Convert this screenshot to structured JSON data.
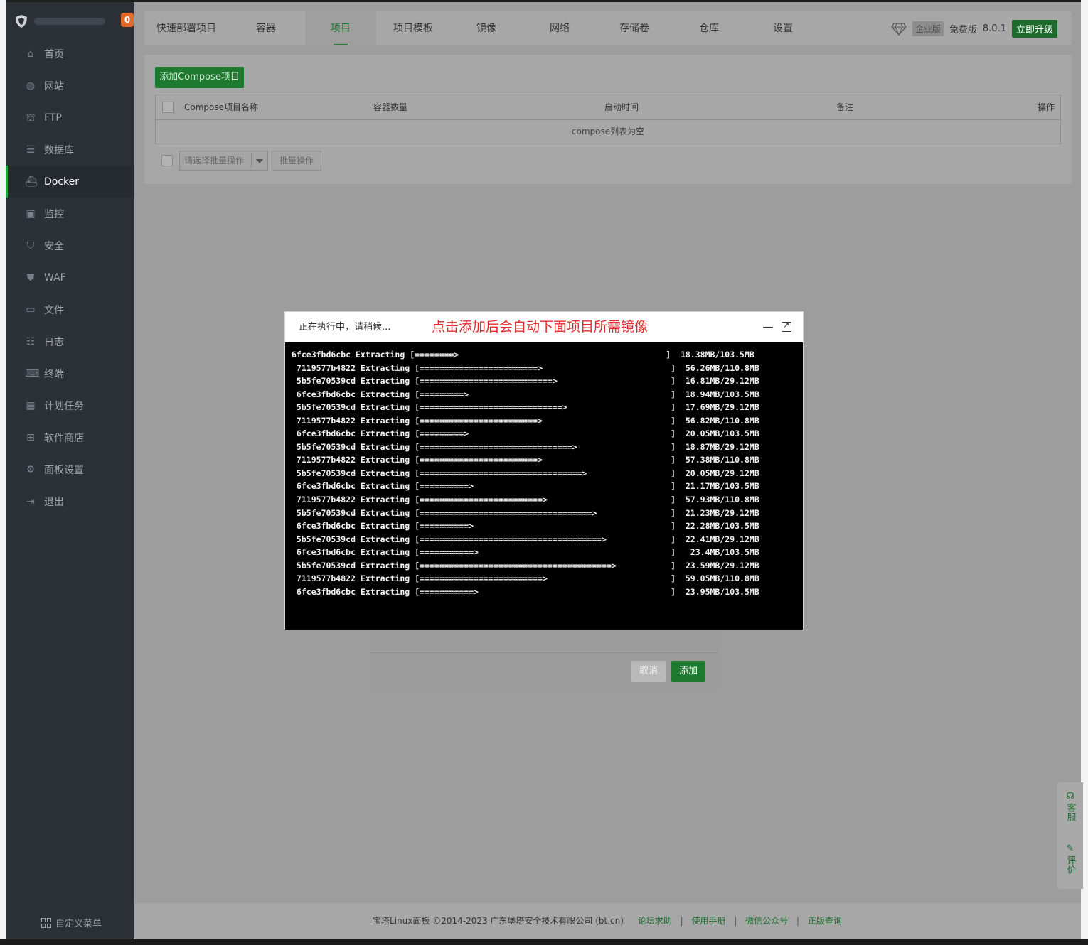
{
  "sidebar": {
    "badge_count": "0",
    "items": [
      {
        "label": "首页",
        "icon": "home-icon"
      },
      {
        "label": "网站",
        "icon": "globe-icon"
      },
      {
        "label": "FTP",
        "icon": "ftp-icon"
      },
      {
        "label": "数据库",
        "icon": "database-icon"
      },
      {
        "label": "Docker",
        "icon": "docker-icon"
      },
      {
        "label": "监控",
        "icon": "monitor-icon"
      },
      {
        "label": "安全",
        "icon": "shield-icon"
      },
      {
        "label": "WAF",
        "icon": "waf-shield-icon"
      },
      {
        "label": "文件",
        "icon": "folder-icon"
      },
      {
        "label": "日志",
        "icon": "log-icon"
      },
      {
        "label": "终端",
        "icon": "terminal-icon"
      },
      {
        "label": "计划任务",
        "icon": "calendar-icon"
      },
      {
        "label": "软件商店",
        "icon": "apps-icon"
      },
      {
        "label": "面板设置",
        "icon": "gear-icon"
      },
      {
        "label": "退出",
        "icon": "logout-icon"
      }
    ],
    "active": "Docker",
    "custom_menu": "自定义菜单"
  },
  "topnav": {
    "tabs": [
      "快速部署项目",
      "容器",
      "项目",
      "项目模板",
      "镜像",
      "网络",
      "存储卷",
      "仓库",
      "设置"
    ],
    "active_tab": "项目",
    "enterprise": "企业版",
    "free": "免费版",
    "version": "8.0.1",
    "upgrade": "立即升级"
  },
  "content": {
    "add_button": "添加Compose项目",
    "columns": [
      "Compose项目名称",
      "容器数量",
      "启动时间",
      "备注",
      "操作"
    ],
    "empty_text": "compose列表为空",
    "batch_select_placeholder": "请选择批量操作",
    "batch_button": "批量操作"
  },
  "form_dialog": {
    "cancel": "取消",
    "add": "添加"
  },
  "modal": {
    "title": "正在执行中，请稍候...",
    "annotation": "点击添加后会自动下面项目所需镜像",
    "log_lines": [
      "6fce3fbd6cbc Extracting [========>                                          ]  18.38MB/103.5MB",
      " 7119577b4822 Extracting [========================>                          ]  56.26MB/110.8MB",
      " 5b5fe70539cd Extracting [===========================>                       ]  16.81MB/29.12MB",
      " 6fce3fbd6cbc Extracting [=========>                                         ]  18.94MB/103.5MB",
      " 5b5fe70539cd Extracting [=============================>                     ]  17.69MB/29.12MB",
      " 7119577b4822 Extracting [========================>                          ]  56.82MB/110.8MB",
      " 6fce3fbd6cbc Extracting [=========>                                         ]  20.05MB/103.5MB",
      " 5b5fe70539cd Extracting [===============================>                   ]  18.87MB/29.12MB",
      " 7119577b4822 Extracting [========================>                          ]  57.38MB/110.8MB",
      " 5b5fe70539cd Extracting [=================================>                 ]  20.05MB/29.12MB",
      " 6fce3fbd6cbc Extracting [==========>                                        ]  21.17MB/103.5MB",
      " 7119577b4822 Extracting [=========================>                         ]  57.93MB/110.8MB",
      " 5b5fe70539cd Extracting [===================================>               ]  21.23MB/29.12MB",
      " 6fce3fbd6cbc Extracting [==========>                                        ]  22.28MB/103.5MB",
      " 5b5fe70539cd Extracting [=====================================>             ]  22.41MB/29.12MB",
      " 6fce3fbd6cbc Extracting [===========>                                       ]   23.4MB/103.5MB",
      " 5b5fe70539cd Extracting [=======================================>           ]  23.59MB/29.12MB",
      " 7119577b4822 Extracting [=========================>                         ]  59.05MB/110.8MB",
      " 6fce3fbd6cbc Extracting [===========>                                       ]  23.95MB/103.5MB"
    ]
  },
  "footer": {
    "copyright": "宝塔Linux面板 ©2014-2023 广东堡塔安全技术有限公司 (bt.cn)",
    "links": [
      "论坛求助",
      "使用手册",
      "微信公众号",
      "正版查询"
    ]
  },
  "float_help": {
    "service": "客服",
    "review": "评价"
  },
  "colors": {
    "accent_green": "#20a53a",
    "annotation_red": "#e02b2b",
    "sidebar_bg": "#2c3138",
    "badge_orange": "#e0692c"
  }
}
